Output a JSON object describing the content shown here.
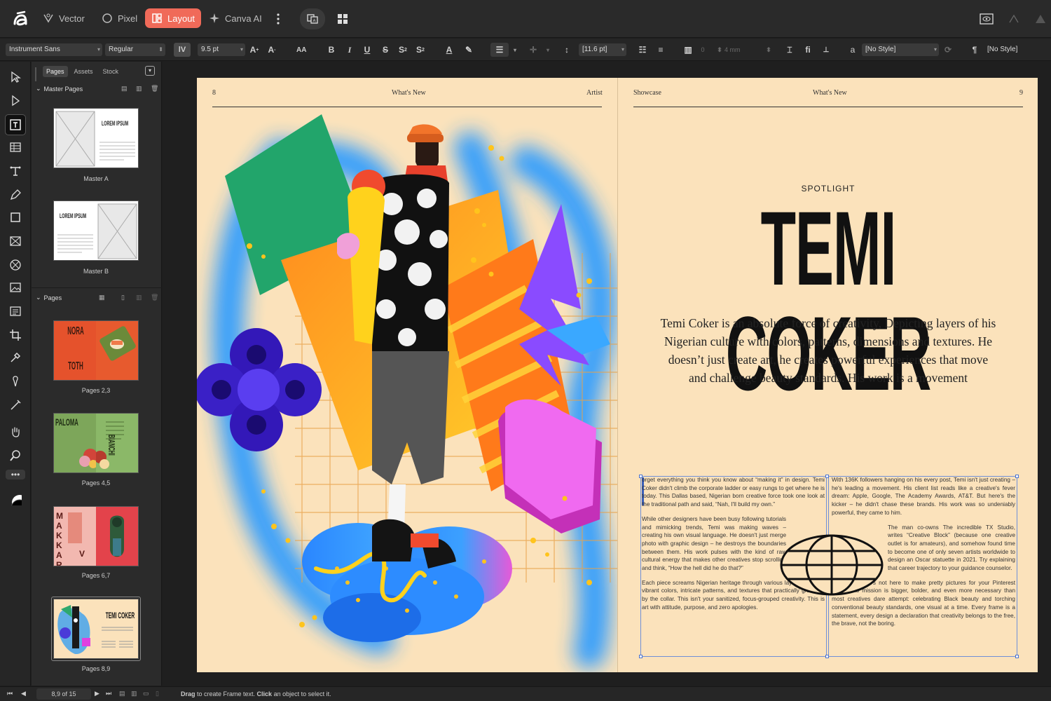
{
  "modes": {
    "vector": "Vector",
    "pixel": "Pixel",
    "layout": "Layout",
    "canva_ai": "Canva AI"
  },
  "options": {
    "font_family": "Instrument Sans",
    "font_style": "Regular",
    "font_size": "9.5 pt",
    "leading": "[11.6 pt]",
    "columns": "0",
    "gutter": "4 mm",
    "char_style": "[No Style]",
    "para_style": "[No Style]",
    "aa": "AA"
  },
  "panel": {
    "tabs": [
      "Pages",
      "Assets",
      "Stock"
    ],
    "master_pages_title": "Master Pages",
    "masters": [
      {
        "label": "Master A",
        "text": "LOREM IPSUM"
      },
      {
        "label": "Master B",
        "text": "LOREM IPSUM"
      }
    ],
    "pages_title": "Pages",
    "pages": [
      {
        "label": "Pages 2,3",
        "text_a": "NORA",
        "text_b": "TOTH"
      },
      {
        "label": "Pages 4,5",
        "text_a": "PALOMA",
        "text_b": "BIANCHI"
      },
      {
        "label": "Pages 6,7",
        "text_a": "M A K K A R",
        "text_b": "V"
      },
      {
        "label": "Pages 8,9",
        "text_a": "TEMI COKER"
      }
    ]
  },
  "spread": {
    "left": {
      "page_num": "8",
      "center": "What's New",
      "right": "Artist"
    },
    "right": {
      "left": "Showcase",
      "center": "What's New",
      "page_num": "9"
    },
    "kicker": "SPOTLIGHT",
    "title": "TEMI COKER",
    "deck": "Temi Coker is an absolute force of creativity, Depicting layers of his Nigerian culture with colors, patterns, dimensions and textures. He doesn’t just create art, he creates powerful experiences that move and challenge beauty standards. His work is a movement",
    "col1": [
      "orget everything you think you know about “making it” in design. Temi Coker didn't climb the corporate ladder or easy rungs to get where he is today. This Dallas based, Nigerian born creative force took one look at the traditional path and said, “Nah, I'll build my own.”",
      "While other designers have been busy following tutorials and mimicking trends, Temi was making waves – creating his own visual language. He doesn't just merge photo with graphic design – he destroys the boundaries between them. His work pulses with the kind of raw cultural energy that makes other creatives stop scrolling and think, “How the hell did he do that?”",
      "Each piece screams Nigerian heritage through various layers of bright, vibrant colors, intricate patterns, and textures that practically grab you by the collar. This isn't your sanitized, focus-grouped creativity. This is art with attitude, purpose, and zero apologies."
    ],
    "col2": [
      "With 136K followers hanging on his every post, Temi isn't just creating – he's leading a movement. His client list reads like a creative's fever dream: Apple, Google, The Academy Awards, AT&T. But here's the kicker – he didn't chase these brands. His work was so undeniably powerful, they came to him.",
      "The man co-owns The incredible TX Studio, writes “Creative Block” (because one creative outlet is for amateurs), and somehow found time to become one of only seven artists worldwide to design an Oscar statuette in 2021. Try explaining that career trajectory to your guidance counselor.",
      "Temi's not here to make pretty pictures for your Pinterest board. His mission is bigger, bolder, and even more necessary than most creatives dare attempt: celebrating Black beauty and torching conventional beauty standards, one visual at a time. Every frame is a statement, every design a declaration that creativity belongs to the free, the brave, not the boring."
    ]
  },
  "status": {
    "page_indicator": "8,9 of 15",
    "hint_drag": "Drag",
    "hint_mid": " to create Frame text. ",
    "hint_click": "Click",
    "hint_end": " an object to select it."
  }
}
